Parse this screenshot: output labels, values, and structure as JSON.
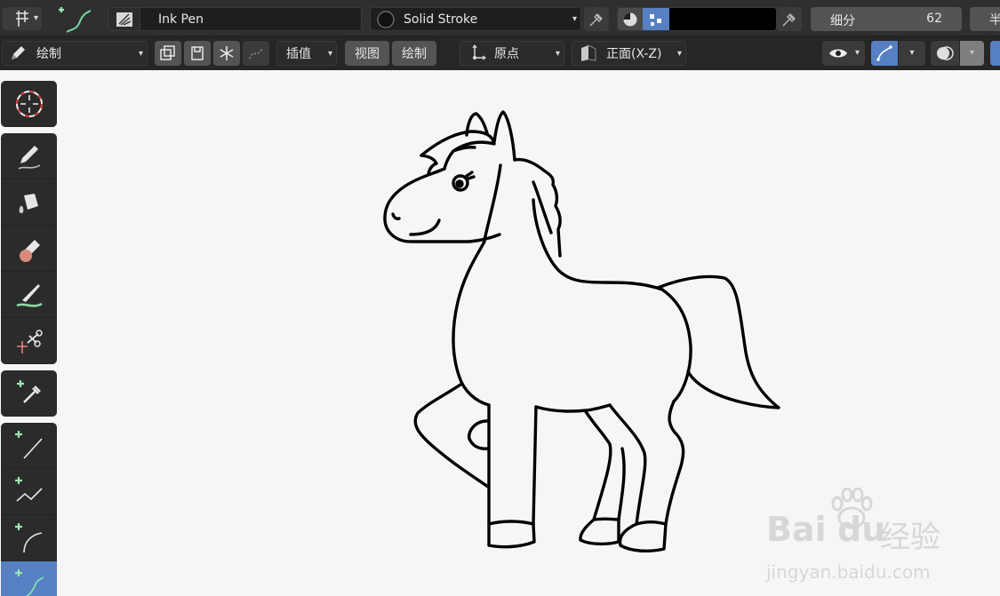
{
  "header": {
    "brush_name": "Ink Pen",
    "material_name": "Solid Stroke",
    "subdivide_label": "细分",
    "subdivide_value": "62",
    "half_label": "半"
  },
  "toolbar2": {
    "mode_label": "绘制",
    "interpolate_label": "插值",
    "view_label": "视图",
    "draw_label": "绘制",
    "origin_label": "原点",
    "front_view_label": "正面(X-Z)"
  },
  "tools": {
    "cursor": "cursor-icon",
    "draw": "draw-pencil-icon",
    "fill": "fill-bucket-icon",
    "erase": "eraser-icon",
    "tint": "tint-brush-icon",
    "cutter": "cutter-scissors-icon",
    "eyedropper": "eyedropper-icon",
    "line": "line-tool-icon",
    "polyline": "polyline-tool-icon",
    "arc": "arc-tool-icon",
    "curve": "curve-tool-icon"
  },
  "colors": {
    "accent_blue": "#5680c2",
    "header_bg": "#2f2f2f",
    "canvas_bg": "#f6f6f6",
    "stroke_color": "#000000",
    "active_tool": "#5680c2"
  },
  "watermark": {
    "brand": "Bai",
    "brand2": "du",
    "cn_text": "经验",
    "url": "jingyan.baidu.com"
  }
}
